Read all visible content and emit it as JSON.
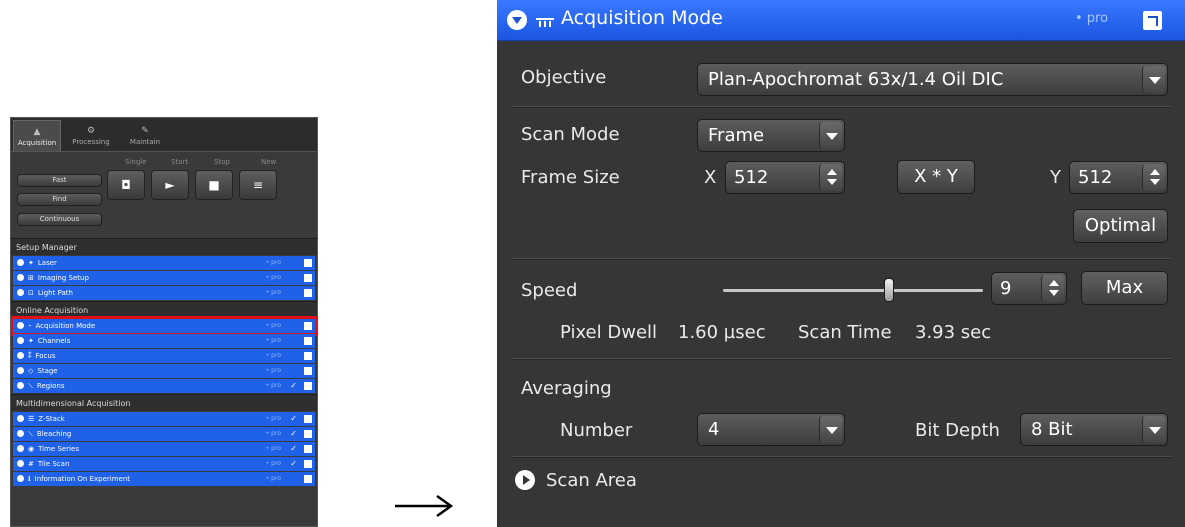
{
  "left_panel": {
    "tabs": [
      {
        "label": "Acquisition",
        "icon": "acquisition-icon"
      },
      {
        "label": "Processing",
        "icon": "processing-icon"
      },
      {
        "label": "Maintain",
        "icon": "maintain-icon"
      }
    ],
    "control_labels": {
      "single": "Single",
      "start": "Start",
      "stop": "Stop",
      "new": "New"
    },
    "buttons": {
      "fast": "Fast",
      "find": "Find",
      "continuous": "Continuous"
    },
    "sections": [
      {
        "title": "Setup Manager",
        "rows": [
          {
            "label": "Laser",
            "pro": "• pro",
            "check": ""
          },
          {
            "label": "Imaging Setup",
            "pro": "• pro",
            "check": ""
          },
          {
            "label": "Light Path",
            "pro": "• pro",
            "check": ""
          }
        ]
      },
      {
        "title": "Online Acquisition",
        "rows": [
          {
            "label": "Acquisition Mode",
            "pro": "• pro",
            "check": ""
          },
          {
            "label": "Channels",
            "pro": "• pro",
            "check": ""
          },
          {
            "label": "Focus",
            "pro": "• pro",
            "check": ""
          },
          {
            "label": "Stage",
            "pro": "• pro",
            "check": ""
          },
          {
            "label": "Regions",
            "pro": "• pro",
            "check": "✓"
          }
        ]
      },
      {
        "title": "Multidimensional Acquisition",
        "rows": [
          {
            "label": "Z-Stack",
            "pro": "• pro",
            "check": "✓"
          },
          {
            "label": "Bleaching",
            "pro": "• pro",
            "check": "✓"
          },
          {
            "label": "Time Series",
            "pro": "• pro",
            "check": "✓"
          },
          {
            "label": "Tile Scan",
            "pro": "• pro",
            "check": "✓"
          },
          {
            "label": "Information On Experiment",
            "pro": "• pro",
            "check": ""
          }
        ]
      }
    ],
    "highlight_color": "#e0101a"
  },
  "arrow": {
    "glyph": "→"
  },
  "panel": {
    "title": "Acquisition Mode",
    "pro_badge": "• pro",
    "objective": {
      "label": "Objective",
      "value": "Plan-Apochromat 63x/1.4 Oil DIC"
    },
    "scan_mode": {
      "label": "Scan Mode",
      "value": "Frame"
    },
    "frame_size": {
      "label": "Frame Size",
      "x_label": "X",
      "x_value": "512",
      "xy_button": "X * Y",
      "y_label": "Y",
      "y_value": "512",
      "optimal_button": "Optimal"
    },
    "speed": {
      "label": "Speed",
      "value": "9",
      "max_button": "Max",
      "slider_fraction": 0.64
    },
    "pixel_dwell": {
      "label": "Pixel Dwell",
      "value": "1.60 µsec"
    },
    "scan_time": {
      "label": "Scan Time",
      "value": "3.93 sec"
    },
    "averaging": {
      "label": "Averaging",
      "number_label": "Number",
      "number_value": "4",
      "bit_depth_label": "Bit Depth",
      "bit_depth_value": "8 Bit"
    },
    "scan_area": {
      "label": "Scan Area"
    },
    "colors": {
      "header_blue": "#1a56e0",
      "panel_bg": "#363636"
    }
  }
}
